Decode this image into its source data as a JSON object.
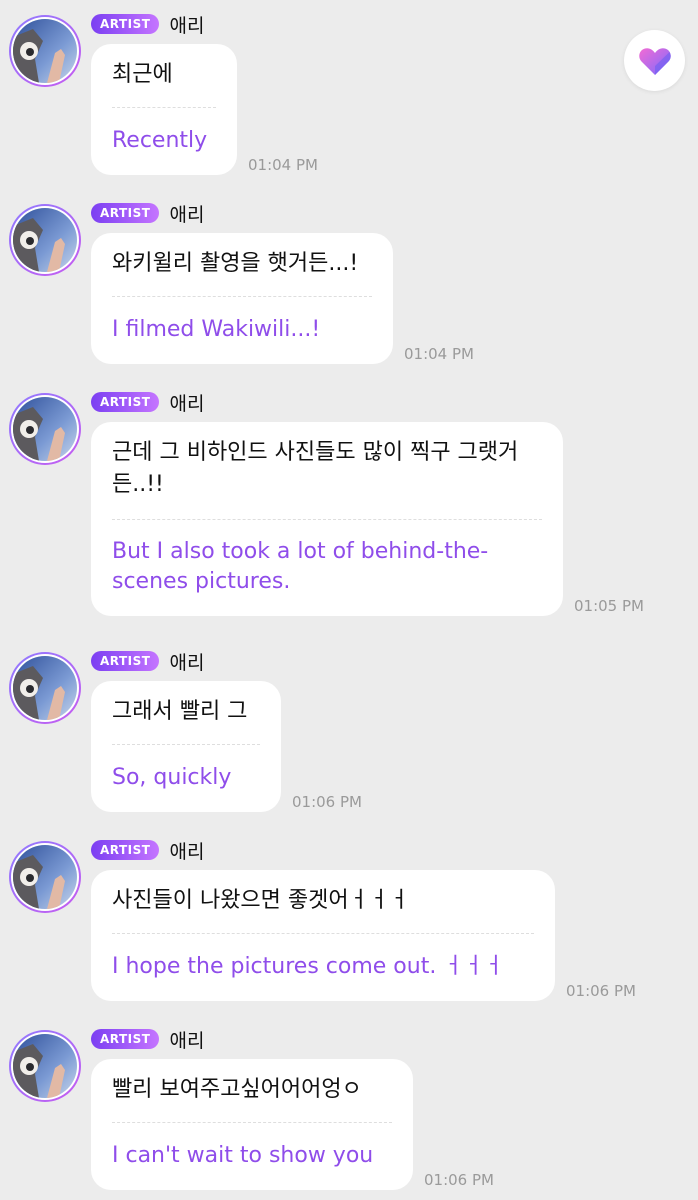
{
  "theme": {
    "background": "#ececec",
    "bubble_bg": "#ffffff",
    "translation_color": "#8f4dea",
    "badge_gradient": [
      "#7b3ff2",
      "#c575ff"
    ],
    "time_color": "#9a9a9a"
  },
  "heart_button": {
    "icon": "heart-icon",
    "colors": [
      "#f36bd4",
      "#7a6bff"
    ]
  },
  "messages": [
    {
      "badge": "ARTIST",
      "name": "애리",
      "original": [
        "최근에"
      ],
      "translation": [
        "Recently"
      ],
      "time": "01:04 PM"
    },
    {
      "badge": "ARTIST",
      "name": "애리",
      "original": [
        "와키윌리 촬영을 햇거든...!"
      ],
      "translation": [
        "I filmed Wakiwili...!"
      ],
      "time": "01:04 PM"
    },
    {
      "badge": "ARTIST",
      "name": "애리",
      "original": [
        "근데 그 비하인드 사진들도 많이 찍구 그랫거",
        "든..!!"
      ],
      "translation": [
        "But I also took a lot of behind-the-",
        "scenes pictures."
      ],
      "time": "01:05 PM"
    },
    {
      "badge": "ARTIST",
      "name": "애리",
      "original": [
        "그래서 빨리 그"
      ],
      "translation": [
        "So, quickly"
      ],
      "time": "01:06 PM"
    },
    {
      "badge": "ARTIST",
      "name": "애리",
      "original": [
        "사진들이 나왔으면 좋겟어ㅓㅓㅓ"
      ],
      "translation": [
        "I hope the pictures come out. ㅓㅓㅓ"
      ],
      "time": "01:06 PM"
    },
    {
      "badge": "ARTIST",
      "name": "애리",
      "original": [
        "빨리 보여주고싶어어어엉ㅇ"
      ],
      "translation": [
        "I can't wait to show you"
      ],
      "time": "01:06 PM"
    }
  ]
}
